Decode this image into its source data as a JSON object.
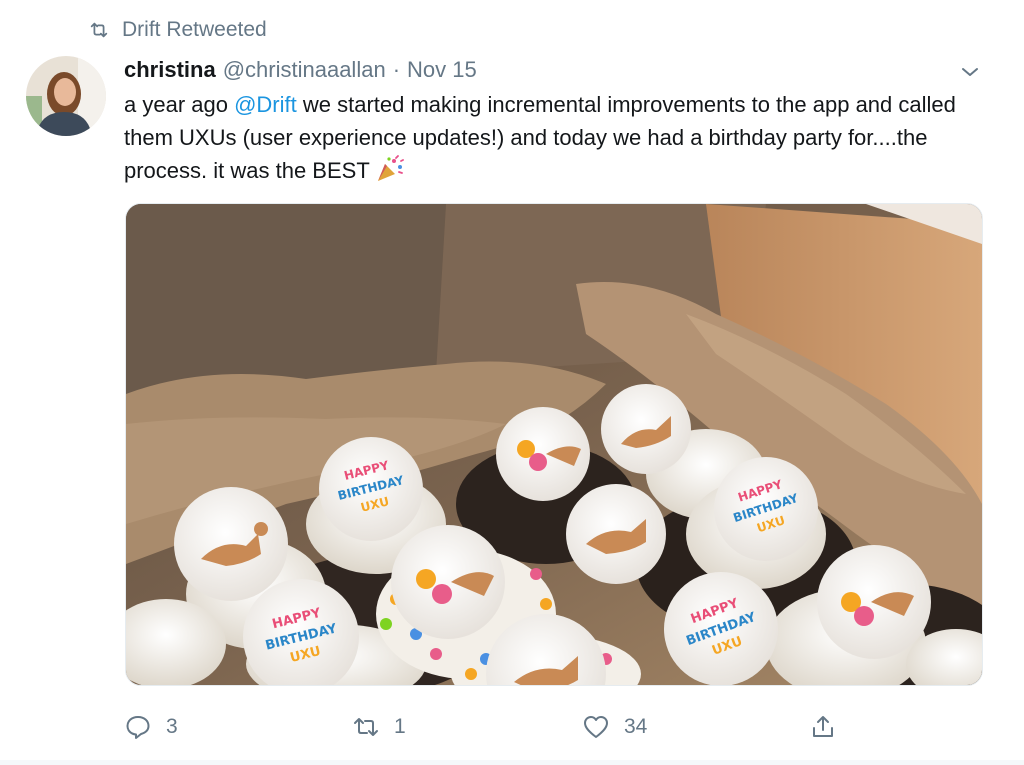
{
  "retweet_context": {
    "icon": "retweet-icon",
    "label": "Drift Retweeted"
  },
  "tweet": {
    "author_name": "christina",
    "author_handle": "@christinaaallan",
    "separator": "·",
    "date": "Nov 15",
    "text_parts": [
      "a year ago ",
      "@Drift",
      " we started making incremental improvements to the app and called them UXUs (user experience updates!) and today we had a birthday party for....the process. it was the BEST"
    ],
    "emoji": "party-popper-icon"
  },
  "media": {
    "cupcake_topper_lines": [
      "HAPPY",
      "BIRTHDAY",
      "UXU"
    ]
  },
  "actions": {
    "reply_count": "3",
    "retweet_count": "1",
    "like_count": "34"
  },
  "colors": {
    "link": "#1b95e0",
    "muted": "#657786",
    "text": "#14171a"
  }
}
